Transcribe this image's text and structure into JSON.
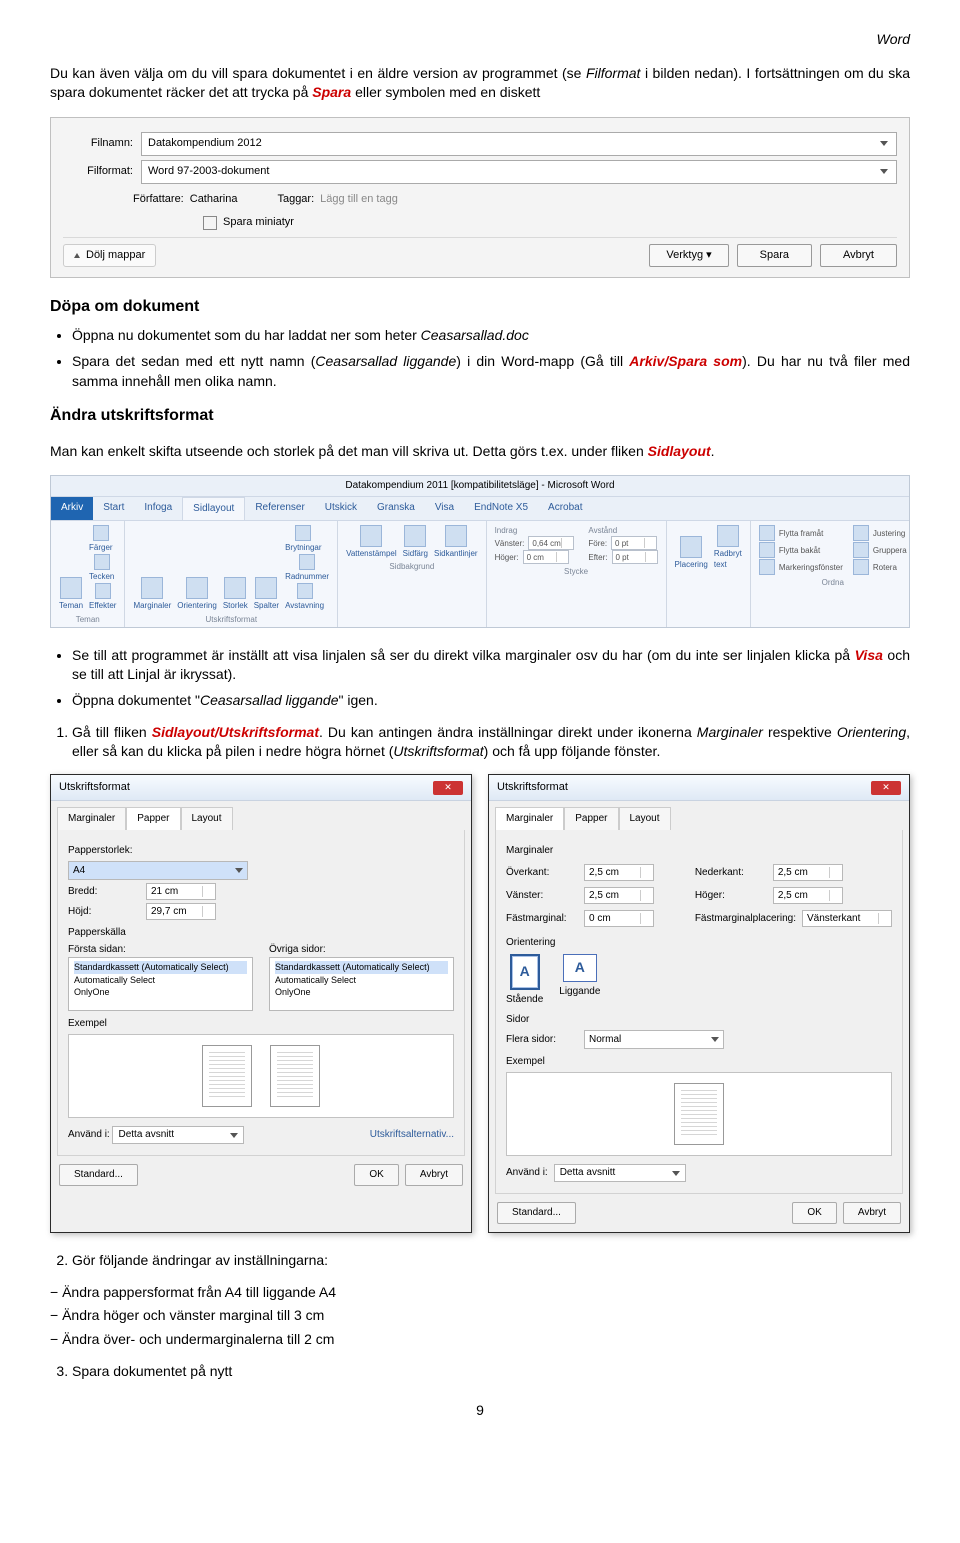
{
  "header": {
    "word": "Word"
  },
  "intro": {
    "part1": "Du kan även välja om du vill spara dokumentet i en äldre version av programmet (se ",
    "filformat": "Filformat",
    "part2": " i bilden nedan). I fortsättningen om du ska spara dokumentet räcker det att trycka på ",
    "spara": "Spara",
    "part3": " eller symbolen med en diskett"
  },
  "saveas": {
    "filnamn_label": "Filnamn:",
    "filnamn_value": "Datakompendium 2012",
    "filformat_label": "Filformat:",
    "filformat_value": "Word 97-2003-dokument",
    "forfattare_label": "Författare:",
    "forfattare_value": "Catharina",
    "taggar_label": "Taggar:",
    "taggar_value": "Lägg till en tagg",
    "sparamini": "Spara miniatyr",
    "dolj": "Dölj mappar",
    "verktyg": "Verktyg",
    "spara_btn": "Spara",
    "avbryt_btn": "Avbryt"
  },
  "dopa": {
    "heading": "Döpa om dokument",
    "b1a": "Öppna nu dokumentet som du har laddat ner som heter ",
    "b1b": "Ceasarsallad.doc",
    "b2a": "Spara det sedan med ett nytt namn (",
    "b2b": "Ceasarsallad liggande",
    "b2c": ") i din Word-mapp (Gå till ",
    "b2d": "Arkiv/Spara som",
    "b2e": "). Du har nu två filer med samma innehåll men olika namn."
  },
  "andra": {
    "heading": "Ändra utskriftsformat",
    "p1a": "Man kan enkelt skifta utseende och storlek på det man vill skriva ut. Detta görs t.ex. under fliken ",
    "p1b": "Sidlayout",
    "p1c": "."
  },
  "ribbon": {
    "title": "Datakompendium 2011 [kompatibilitetsläge] - Microsoft Word",
    "tabs": {
      "arkiv": "Arkiv",
      "start": "Start",
      "infoga": "Infoga",
      "sidlayout": "Sidlayout",
      "referenser": "Referenser",
      "utskick": "Utskick",
      "granska": "Granska",
      "visa": "Visa",
      "endnote": "EndNote X5",
      "acrobat": "Acrobat"
    },
    "groups": {
      "teman": {
        "items": [
          "Teman",
          "Färger",
          "Tecken",
          "Effekter"
        ],
        "label": "Teman"
      },
      "utskrift": {
        "items": [
          "Marginaler",
          "Orientering",
          "Storlek",
          "Spalter",
          "Brytningar",
          "Radnummer",
          "Avstavning"
        ],
        "label": "Utskriftsformat"
      },
      "sidbakgrund": {
        "items": [
          "Vattenstämpel",
          "Sidfärg",
          "Sidkantlinjer"
        ],
        "label": "Sidbakgrund"
      },
      "indrag": {
        "label": "Indrag",
        "vanster": "Vänster:",
        "vval": "0,64 cm",
        "hoger": "Höger:",
        "hval": "0 cm"
      },
      "avstand": {
        "label": "Avstånd",
        "fore": "Före:",
        "fval": "0 pt",
        "efter": "Efter:",
        "eval": "0 pt",
        "glabel": "Stycke"
      },
      "placering": {
        "items": [
          "Placering",
          "Radbryt text"
        ],
        "label": ""
      },
      "ordna": {
        "items": [
          "Flytta framåt",
          "Flytta bakåt",
          "Markeringsfönster",
          "Justering",
          "Gruppera",
          "Rotera"
        ],
        "label": "Ordna"
      }
    }
  },
  "mid": {
    "b1a": "Se till att programmet är inställt att visa linjalen så ser du direkt vilka marginaler osv du har (om du inte ser linjalen klicka på ",
    "b1b": "Visa",
    "b1c": " och se till att Linjal är ikryssat).",
    "b2a": "Öppna dokumentet \"",
    "b2b": "Ceasarsallad liggande",
    "b2c": "\" igen.",
    "li1a": "Gå till fliken ",
    "li1b": "Sidlayout/Utskriftsformat",
    "li1c": ". Du kan antingen ändra inställningar direkt under ikonerna ",
    "li1d": "Marginaler",
    "li1e": " respektive ",
    "li1f": "Orientering",
    "li1g": ", eller så kan du klicka på pilen i nedre högra hörnet (",
    "li1h": "Utskriftsformat",
    "li1i": ") och få upp följande fönster."
  },
  "dlgL": {
    "title": "Utskriftsformat",
    "tabs": {
      "marginaler": "Marginaler",
      "papper": "Papper",
      "layout": "Layout"
    },
    "pappersstorlek": "Papperstorlek:",
    "a4": "A4",
    "bredd_l": "Bredd:",
    "bredd_v": "21 cm",
    "hojd_l": "Höjd:",
    "hojd_v": "29,7 cm",
    "papperskalla": "Papperskälla",
    "forsta": "Första sidan:",
    "ovriga": "Övriga sidor:",
    "opt1": "Standardkassett (Automatically Select)",
    "opt2": "Automatically Select",
    "opt3": "OnlyOne",
    "exempel": "Exempel",
    "anvand_l": "Använd i:",
    "anvand_v": "Detta avsnitt",
    "utalt": "Utskriftsalternativ...",
    "standard": "Standard...",
    "ok": "OK",
    "avbryt": "Avbryt"
  },
  "dlgR": {
    "title": "Utskriftsformat",
    "tabs": {
      "marginaler": "Marginaler",
      "papper": "Papper",
      "layout": "Layout"
    },
    "marginaler": "Marginaler",
    "over_l": "Överkant:",
    "over_v": "2,5 cm",
    "ned_l": "Nederkant:",
    "ned_v": "2,5 cm",
    "van_l": "Vänster:",
    "van_v": "2,5 cm",
    "hog_l": "Höger:",
    "hog_v": "2,5 cm",
    "fast_l": "Fästmarginal:",
    "fast_v": "0 cm",
    "fastp_l": "Fästmarginalplacering:",
    "fastp_v": "Vänsterkant",
    "orient_h": "Orientering",
    "staende": "Stående",
    "liggande": "Liggande",
    "sidor_h": "Sidor",
    "flera_l": "Flera sidor:",
    "flera_v": "Normal",
    "exempel": "Exempel",
    "anvand_l": "Använd i:",
    "anvand_v": "Detta avsnitt",
    "standard": "Standard...",
    "ok": "OK",
    "avbryt": "Avbryt"
  },
  "end": {
    "li2": "Gör följande ändringar av inställningarna:",
    "d1": "Ändra pappersformat från A4 till liggande A4",
    "d2": "Ändra höger och vänster marginal till 3 cm",
    "d3": "Ändra över- och undermarginalerna till 2 cm",
    "li3": "Spara dokumentet på nytt"
  },
  "page": "9"
}
